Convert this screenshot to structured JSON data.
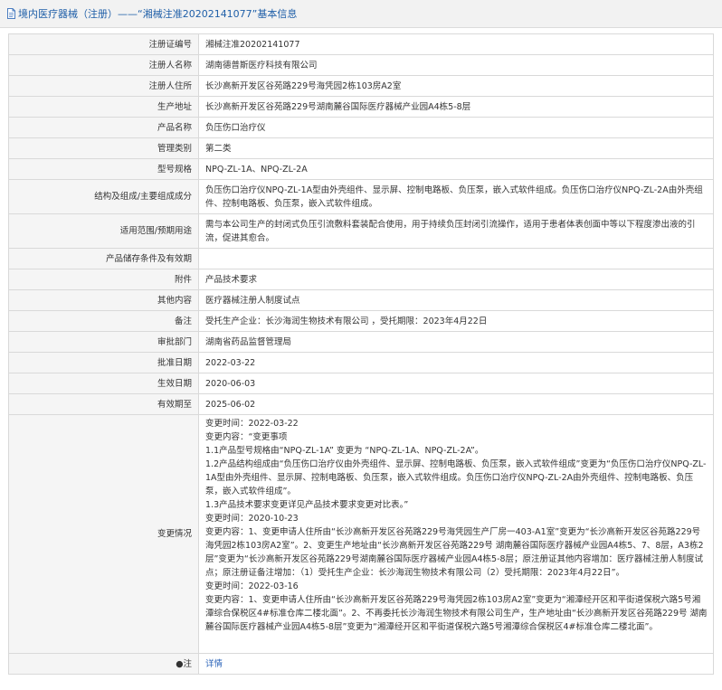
{
  "header": {
    "title": "境内医疗器械（注册）——“湘械注准20202141077”基本信息"
  },
  "rows": [
    {
      "label": "注册证编号",
      "value": "湘械注准20202141077"
    },
    {
      "label": "注册人名称",
      "value": "湖南德普斯医疗科技有限公司"
    },
    {
      "label": "注册人住所",
      "value": "长沙高新开发区谷苑路229号海凭园2栋103房A2室"
    },
    {
      "label": "生产地址",
      "value": "长沙高新开发区谷苑路229号湖南麓谷国际医疗器械产业园A4栋5-8层"
    },
    {
      "label": "产品名称",
      "value": "负压伤口治疗仪"
    },
    {
      "label": "管理类别",
      "value": "第二类"
    },
    {
      "label": "型号规格",
      "value": "NPQ-ZL-1A、NPQ-ZL-2A"
    },
    {
      "label": "结构及组成/主要组成成分",
      "value": "负压伤口治疗仪NPQ-ZL-1A型由外壳组件、显示屏、控制电路板、负压泵，嵌入式软件组成。负压伤口治疗仪NPQ-ZL-2A由外壳组件、控制电路板、负压泵，嵌入式软件组成。"
    },
    {
      "label": "适用范围/预期用途",
      "value": "需与本公司生产的封闭式负压引流敷料套装配合使用，用于持续负压封闭引流操作，适用于患者体表创面中等以下程度渗出液的引流，促进其愈合。"
    },
    {
      "label": "产品储存条件及有效期",
      "value": ""
    },
    {
      "label": "附件",
      "value": "产品技术要求"
    },
    {
      "label": "其他内容",
      "value": "医疗器械注册人制度试点"
    },
    {
      "label": "备注",
      "value": "受托生产企业：长沙海润生物技术有限公司 ，受托期限：2023年4月22日"
    },
    {
      "label": "审批部门",
      "value": "湖南省药品监督管理局"
    },
    {
      "label": "批准日期",
      "value": "2022-03-22"
    },
    {
      "label": "生效日期",
      "value": "2020-06-03"
    },
    {
      "label": "有效期至",
      "value": "2025-06-02"
    }
  ],
  "changes": {
    "label": "变更情况",
    "lines": [
      "变更时间：2022-03-22",
      "变更内容：“变更事项",
      "1.1产品型号规格由“NPQ-ZL-1A” 变更为 “NPQ-ZL-1A、NPQ-ZL-2A”。",
      "1.2产品结构组成由“负压伤口治疗仪由外壳组件、显示屏、控制电路板、负压泵，嵌入式软件组成”变更为“负压伤口治疗仪NPQ-ZL-1A型由外壳组件、显示屏、控制电路板、负压泵，嵌入式软件组成。负压伤口治疗仪NPQ-ZL-2A由外壳组件、控制电路板、负压泵，嵌入式软件组成”。",
      "1.3产品技术要求变更详见产品技术要求变更对比表。”",
      "变更时间：2020-10-23",
      "变更内容：1、变更申请人住所由“长沙高新开发区谷苑路229号海凭园生产厂房一403-A1室”变更为“长沙高新开发区谷苑路229号海凭园2栋103房A2室”。2、变更生产地址由“长沙高新开发区谷苑路229号 湖南麓谷国际医疗器械产业园A4栋5、7、8层，A3栋2层”变更为“长沙高新开发区谷苑路229号湖南麓谷国际医疗器械产业园A4栋5-8层；原注册证其他内容增加：医疗器械注册人制度试点；原注册证备注增加：（1）受托生产企业：长沙海润生物技术有限公司（2）受托期限：2023年4月22日”。",
      "变更时间：2022-03-16",
      "变更内容：1、变更申请人住所由“长沙高新开发区谷苑路229号海凭园2栋103房A2室”变更为“湘潭经开区和平街道保税六路5号湘潭综合保税区4#标准仓库二楼北面”。2、不再委托长沙海润生物技术有限公司生产，生产地址由“长沙高新开发区谷苑路229号 湖南麓谷国际医疗器械产业园A4栋5-8层”变更为“湘潭经开区和平街道保税六路5号湘潭综合保税区4#标准仓库二楼北面”。"
    ]
  },
  "footer_row": {
    "label": "注",
    "link_text": "详情"
  }
}
